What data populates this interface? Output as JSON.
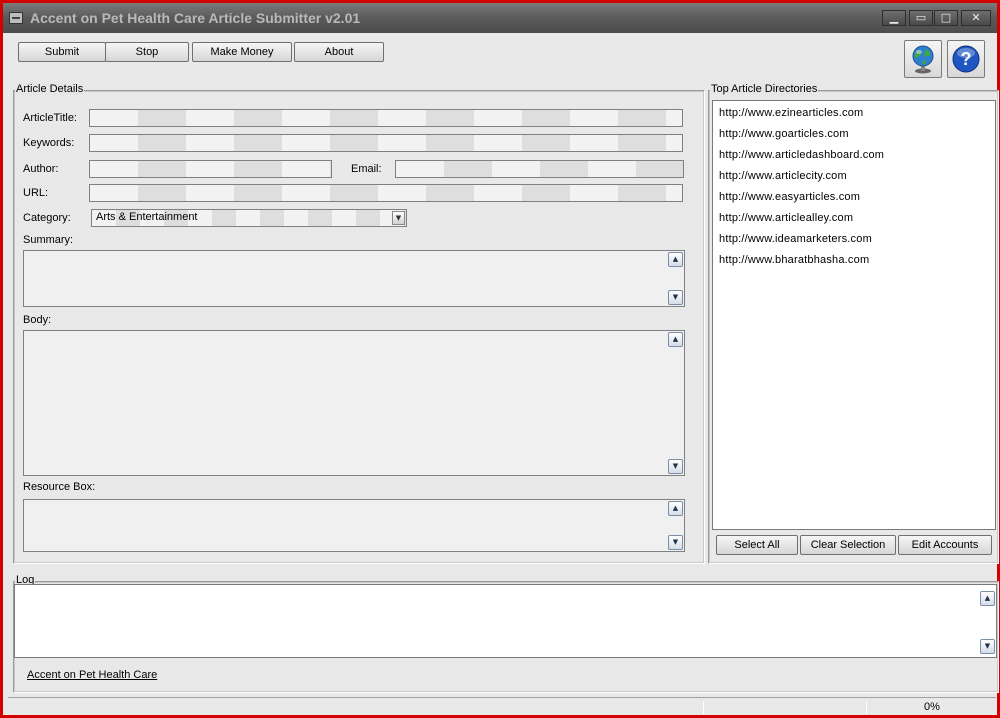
{
  "window": {
    "title": "Accent on Pet Health Care Article Submitter v2.01",
    "controls": {
      "minimize": "▁",
      "restore": "▭",
      "maximize": "□",
      "close": "✕"
    }
  },
  "toolbar": {
    "submit": "Submit",
    "stop": "Stop",
    "make_money": "Make Money",
    "about": "About",
    "globe_icon": "globe-icon",
    "help_icon": "help-icon",
    "help_glyph": "?"
  },
  "article": {
    "legend": "Article Details",
    "title_label": "ArticleTitle:",
    "title_value": "",
    "keywords_label": "Keywords:",
    "keywords_value": "",
    "author_label": "Author:",
    "author_value": "",
    "email_label": "Email:",
    "email_value": "",
    "url_label": "URL:",
    "url_value": "",
    "category_label": "Category:",
    "category_value": "Arts & Entertainment",
    "summary_label": "Summary:",
    "body_label": "Body:",
    "resource_label": "Resource Box:"
  },
  "directories": {
    "legend": "Top Article Directories",
    "items": [
      "http://www.ezinearticles.com",
      "http://www.goarticles.com",
      "http://www.articledashboard.com",
      "http://www.articlecity.com",
      "http://www.easyarticles.com",
      "http://www.articlealley.com",
      "http://www.ideamarketers.com",
      "http://www.bharatbhasha.com"
    ],
    "select_all": "Select All",
    "clear_selection": "Clear Selection",
    "edit_accounts": "Edit Accounts"
  },
  "log": {
    "legend": "Log",
    "link": "Accent on Pet Health Care"
  },
  "status": {
    "progress": "0%"
  },
  "colors": {
    "frame": "#d40000",
    "titlebar": "#5a5a5a",
    "title_text": "#b9b9b9",
    "globe": "#2f7fd0",
    "help": "#1f56c2"
  }
}
